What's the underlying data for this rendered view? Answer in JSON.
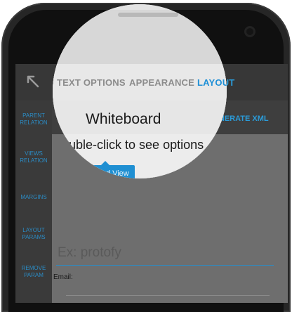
{
  "tabs": [
    {
      "label": "TEXT OPTIONS"
    },
    {
      "label": "APPEARANCE"
    },
    {
      "label": "LAYOUT",
      "active": true
    }
  ],
  "sidebar": {
    "items": [
      {
        "label": "PARENT RELATION"
      },
      {
        "label": "VIEWS RELATION"
      },
      {
        "label": "MARGINS"
      },
      {
        "label": "LAYOUT PARAMS"
      },
      {
        "label": "REMOVE PARAM"
      }
    ]
  },
  "header": {
    "title": "Whiteboard",
    "generate_label": "GENERATE XML"
  },
  "hint": "Double-click to see options",
  "selected_view_label": "Selected View",
  "form": {
    "placeholder": "Ex: protofy",
    "email_label": "Email:"
  },
  "colors": {
    "accent": "#2b9bd8",
    "selected": "#1f8fd2"
  },
  "icons": {
    "back": "back-arrow-icon"
  }
}
